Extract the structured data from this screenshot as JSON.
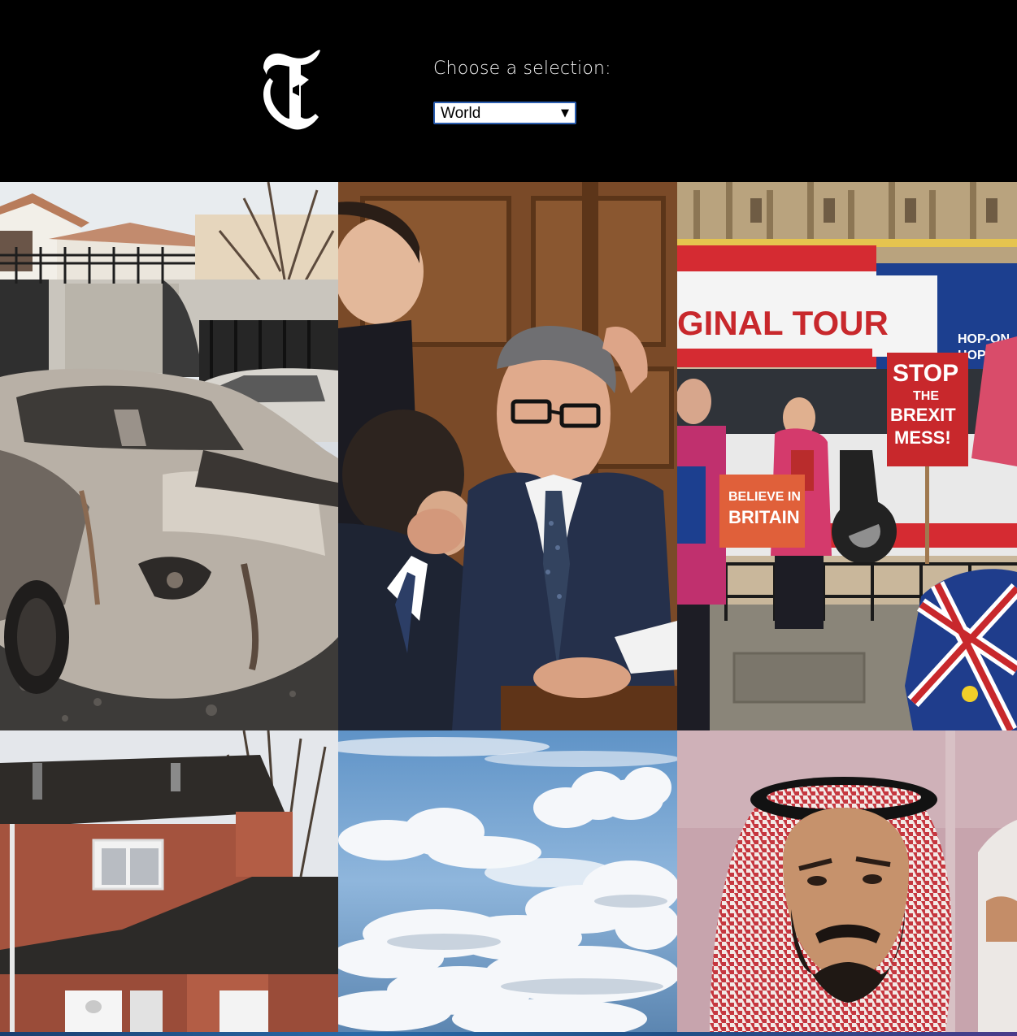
{
  "header": {
    "logo_letter": "T",
    "selector_label": "Choose a selection:",
    "selected_section": "World",
    "dropdown_arrow": "▼"
  },
  "tiles": [
    {
      "subject": "burned-car-photo"
    },
    {
      "subject": "parliament-politician-photo"
    },
    {
      "subject": "brexit-protest-photo",
      "signs": {
        "bus_banner": "GINAL TOUR",
        "hop": "HOP-ON",
        "hop2": "HOP-OFF",
        "stop": "STOP",
        "the": "THE",
        "brexit": "BREXIT",
        "mess": "MESS!",
        "believe": "BELIEVE IN",
        "britain": "BRITAIN"
      }
    },
    {
      "subject": "brick-house-photo"
    },
    {
      "subject": "clouds-aerial-photo"
    },
    {
      "subject": "saudi-prince-photo"
    }
  ],
  "colors": {
    "background": "#000000",
    "select_border": "#2a5db0",
    "bus_red": "#d52b32",
    "bus_blue": "#1c3f8f",
    "sign_red": "#c8282c",
    "sign_orange": "#e0603a"
  }
}
